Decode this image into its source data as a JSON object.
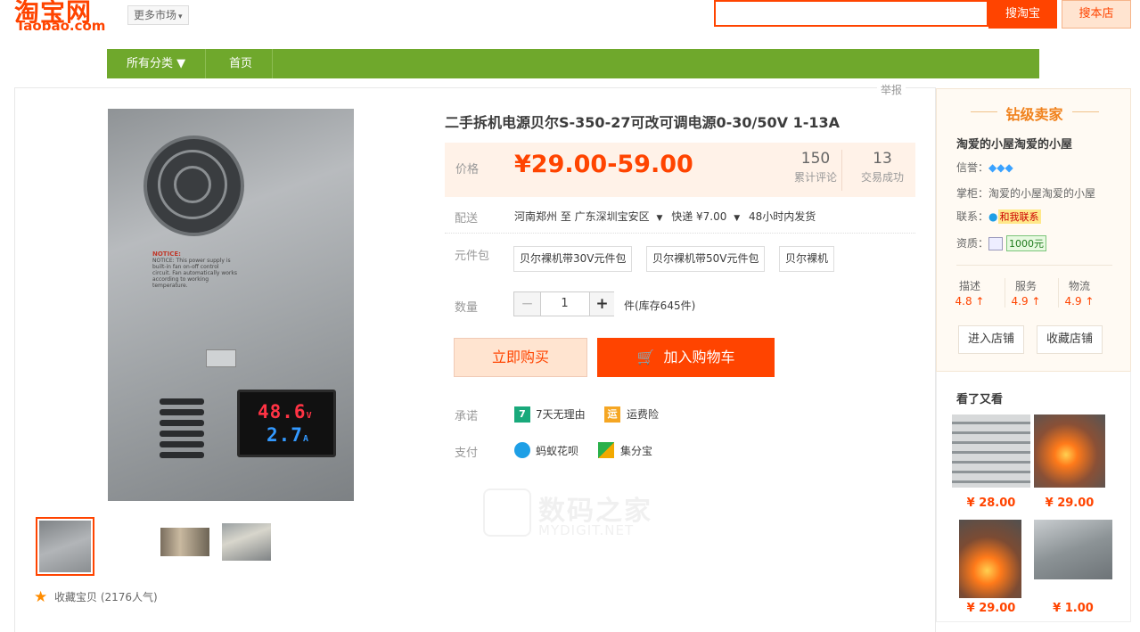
{
  "header": {
    "logo_cn": "淘宝网",
    "logo_en": "Taobao.com",
    "market_label": "更多市场",
    "search_button": "搜淘宝",
    "search_shop_button": "搜本店",
    "search_value": ""
  },
  "nav": {
    "category_label": "所有分类 ▼",
    "home_label": "首页"
  },
  "product": {
    "report_label": "举报",
    "title": "二手拆机电源贝尔S-350-27可改可调电源0-30/50V 1-13A",
    "price_label": "价格",
    "price": "¥29.00-59.00",
    "reviews_count": "150",
    "reviews_label": "累计评论",
    "sales_count": "13",
    "sales_label": "交易成功",
    "shipping_label": "配送",
    "shipping_from": "河南郑州 至 广东深圳宝安区",
    "shipping_method": "快递 ¥7.00",
    "shipping_time": "48小时内发货",
    "options_label": "元件包",
    "options": [
      "贝尔裸机带30V元件包",
      "贝尔裸机带50V元件包",
      "贝尔裸机"
    ],
    "quantity_label": "数量",
    "quantity_value": "1",
    "stock_text": "件(库存645件)",
    "buy_now": "立即购买",
    "add_cart": "加入购物车",
    "promise_label": "承诺",
    "promise_1": "7天无理由",
    "promise_2": "运费险",
    "pay_label": "支付",
    "pay_1": "蚂蚁花呗",
    "pay_2": "集分宝",
    "favorite_text": "收藏宝贝 (2176人气)",
    "meter_voltage": "48.6",
    "meter_unit_v": "V",
    "meter_current": "2.7",
    "meter_unit_a": "A",
    "notice_text": "NOTICE: This power supply is built-in fan on-off control circuit. Fan automatically works according to working temperature."
  },
  "watermark": {
    "cn": "数码之家",
    "en": "MYDIGIT.NET"
  },
  "seller": {
    "grade": "钻级卖家",
    "shop_name": "淘爱的小屋淘爱的小屋",
    "credit_label": "信誉：",
    "credit_diamonds": "💎💎💎",
    "owner_label": "掌柜：",
    "owner_name": "淘爱的小屋淘爱的小屋",
    "contact_label": "联系：",
    "contact_button": "和我联系",
    "qualification_label": "资质：",
    "deposit": "1000元",
    "scores": [
      {
        "label": "描述",
        "value": "4.8 ↑"
      },
      {
        "label": "服务",
        "value": "4.9 ↑"
      },
      {
        "label": "物流",
        "value": "4.9 ↑"
      }
    ],
    "enter_shop": "进入店铺",
    "fav_shop": "收藏店铺"
  },
  "recommend": {
    "title": "看了又看",
    "items": [
      {
        "price": "¥ 28.00"
      },
      {
        "price": "¥ 29.00"
      },
      {
        "price": "¥ 29.00"
      },
      {
        "price": "¥ 1.00"
      }
    ]
  },
  "colors": {
    "accent": "#ff4400",
    "nav_green": "#6fa82c",
    "price_bg": "#fff2e8"
  }
}
